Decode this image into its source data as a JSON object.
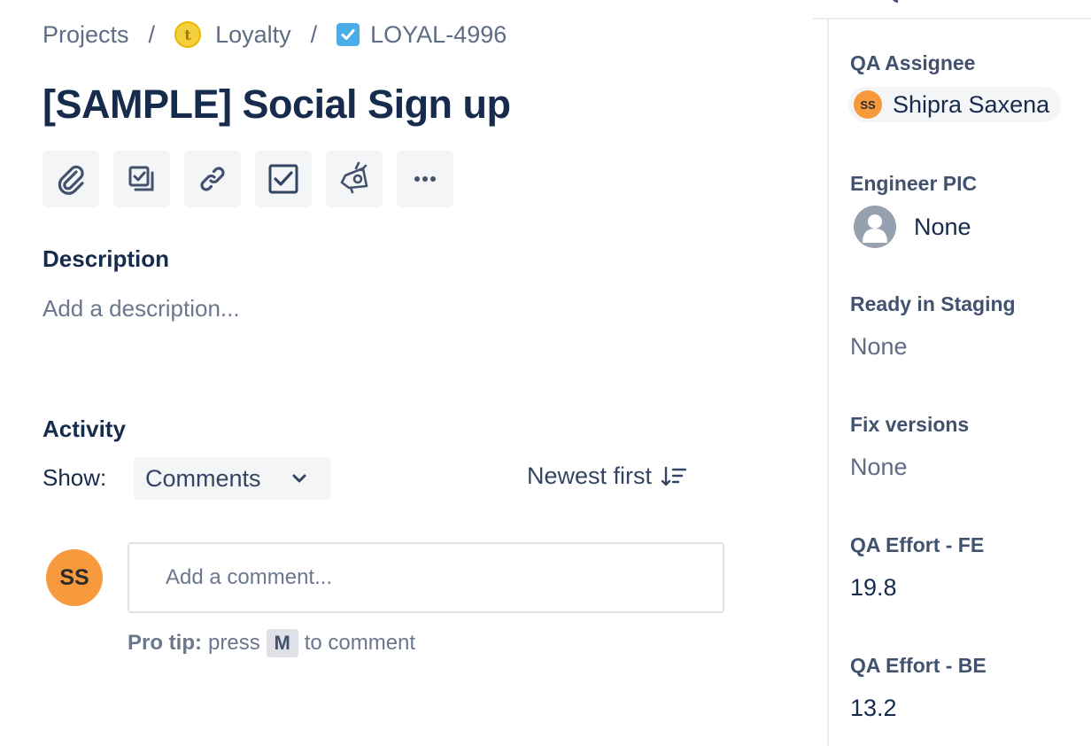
{
  "breadcrumb": {
    "projects": "Projects",
    "separator": "/",
    "project_icon_letter": "t",
    "project": "Loyalty",
    "issue_key": "LOYAL-4996"
  },
  "issue": {
    "title": "[SAMPLE] Social Sign up"
  },
  "toolbar": {
    "buttons": [
      "paperclip-icon",
      "subtask-icon",
      "link-icon",
      "checklist-icon",
      "megaphone-icon",
      "more-icon"
    ]
  },
  "description": {
    "heading": "Description",
    "placeholder": "Add a description..."
  },
  "activity": {
    "heading": "Activity",
    "show_label": "Show:",
    "show_value": "Comments",
    "sort_label": "Newest first"
  },
  "comment": {
    "avatar_initials": "SS",
    "placeholder": "Add a comment...",
    "pro_tip_label": "Pro tip:",
    "pro_tip_press": "press",
    "pro_tip_key": "M",
    "pro_tip_suffix": "to comment"
  },
  "fields": {
    "qa_assignee": {
      "label": "QA Assignee",
      "initials": "SS",
      "name": "Shipra Saxena"
    },
    "engineer_pic": {
      "label": "Engineer PIC",
      "value": "None"
    },
    "ready_in_staging": {
      "label": "Ready in Staging",
      "value": "None"
    },
    "fix_versions": {
      "label": "Fix versions",
      "value": "None"
    },
    "qa_effort_fe": {
      "label": "QA Effort - FE",
      "value": "19.8"
    },
    "qa_effort_be": {
      "label": "QA Effort - BE",
      "value": "13.2"
    }
  },
  "colors": {
    "text_primary": "#172b4d",
    "text_muted": "#5e6c84",
    "avatar_orange": "#f79a3e",
    "issue_type_blue": "#4bade8",
    "button_bg": "#f4f5f7"
  }
}
